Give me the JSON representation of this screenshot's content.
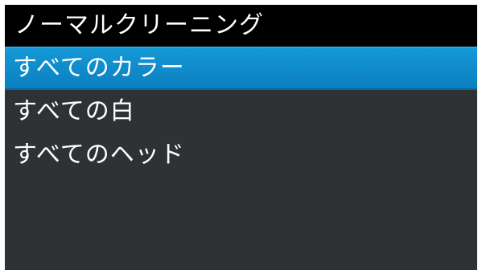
{
  "header": {
    "title": "ノーマルクリーニング"
  },
  "menu": {
    "items": [
      {
        "label": "すべてのカラー",
        "selected": true
      },
      {
        "label": "すべての白",
        "selected": false
      },
      {
        "label": "すべてのヘッド",
        "selected": false
      }
    ]
  },
  "colors": {
    "background": "#2f3235",
    "title_bar": "#000000",
    "selection": "#0a8ccc",
    "text": "#ffffff"
  }
}
